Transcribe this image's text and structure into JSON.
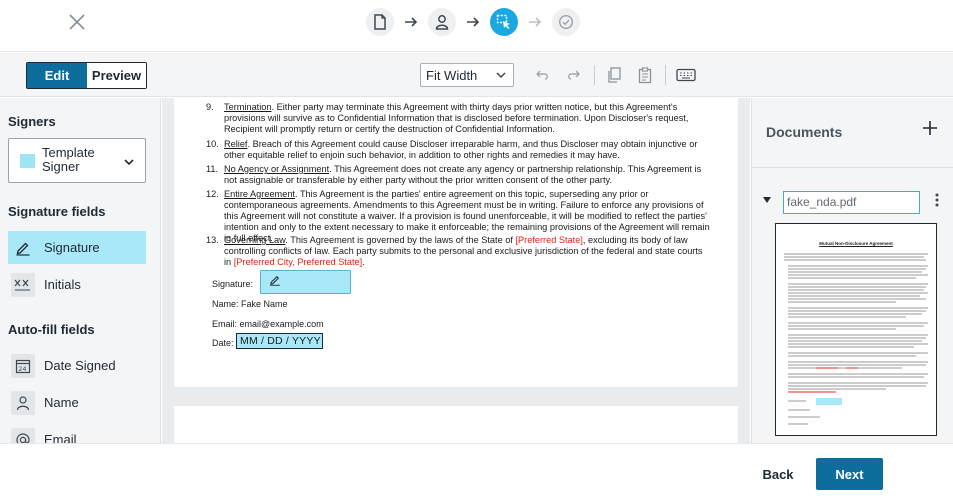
{
  "toolbar": {
    "edit_label": "Edit",
    "preview_label": "Preview",
    "zoom_value": "Fit Width"
  },
  "left_panel": {
    "signers_title": "Signers",
    "signer_name": "Template Signer",
    "signature_fields_title": "Signature fields",
    "signature_label": "Signature",
    "initials_label": "Initials",
    "autofill_title": "Auto-fill fields",
    "date_signed_label": "Date Signed",
    "name_label": "Name",
    "email_label": "Email"
  },
  "document": {
    "clauses": [
      {
        "num": "9.",
        "title": "Termination",
        "text": ". Either party may terminate this Agreement with thirty days prior written notice, but this Agreement's provisions will survive as to Confidential Information that is disclosed before termination. Upon Discloser's request, Recipient will promptly return or certify the destruction of Confidential Information."
      },
      {
        "num": "10.",
        "title": "Relief",
        "text": ". Breach of this Agreement could cause Discloser irreparable harm, and thus Discloser may obtain injunctive or other equitable relief to enjoin such behavior, in addition to other rights and remedies it may have."
      },
      {
        "num": "11.",
        "title": "No Agency or Assignment",
        "text": ". This Agreement does not create any agency or partnership relationship. This Agreement is not assignable or transferable by either party without the prior written consent of the other party."
      },
      {
        "num": "12.",
        "title": "Entire Agreement",
        "text": ". This Agreement is the parties' entire agreement on this topic, superseding any prior or contemporaneous agreements. Amendments to this Agreement must be in writing. Failure to enforce any provisions of this Agreement will not constitute a waiver. If a provision is found unenforceable, it will be modified to reflect the parties' intention and only to the extent necessary to make it enforceable; the remaining provisions of the Agreement will remain in full effect."
      }
    ],
    "clause13": {
      "num": "13.",
      "title": "Governing Law",
      "text_a": ". This Agreement is governed by the laws of the State of ",
      "red_a": "[Preferred State]",
      "text_b": ", excluding its body of law controlling conflicts of law. Each party submits to the personal and exclusive jurisdiction of the federal and state courts in ",
      "red_b": "[Preferred City, Preferred State]",
      "text_c": "."
    },
    "signature_label": "Signature:",
    "name_line": "Name: Fake Name",
    "email_line": "Email: email@example.com",
    "date_label": "Date:",
    "date_placeholder": "MM / DD / YYYY"
  },
  "right_panel": {
    "documents_title": "Documents",
    "filename": "fake_nda.pdf",
    "thumb_title": "Mutual Non-Disclosure Agreement"
  },
  "footer": {
    "back_label": "Back",
    "next_label": "Next"
  },
  "colors": {
    "primary": "#0d6d9d",
    "accent": "#1ba8e0",
    "field_highlight": "#a8e8f8",
    "placeholder_red": "#e0241a"
  }
}
